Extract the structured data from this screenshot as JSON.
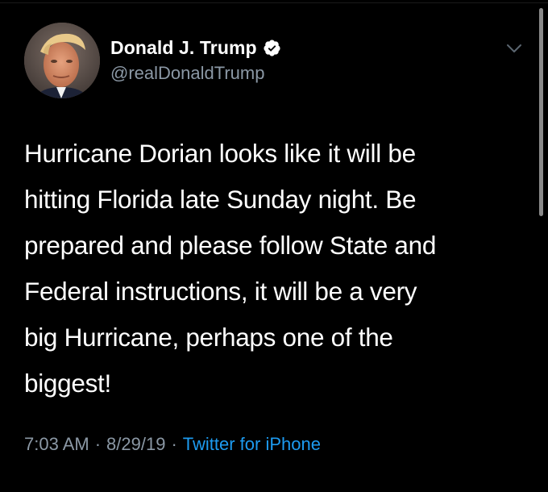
{
  "author": {
    "display_name": "Donald J. Trump",
    "handle": "@realDonaldTrump",
    "verified": true,
    "avatar_icon": "profile-photo"
  },
  "tweet": {
    "text": "Hurricane Dorian looks like it will be\nhitting Florida late Sunday night. Be\nprepared and please follow State and\nFederal instructions, it will be a very\nbig Hurricane, perhaps one of the\nbiggest!",
    "time": "7:03 AM",
    "date": "8/29/19",
    "source": "Twitter for iPhone",
    "separator": "·"
  },
  "icons": {
    "verified": "verified-badge-icon",
    "menu": "chevron-down-icon"
  },
  "colors": {
    "background": "#000000",
    "text": "#ffffff",
    "secondary_text": "#8b98a5",
    "link": "#1d9bf0"
  }
}
